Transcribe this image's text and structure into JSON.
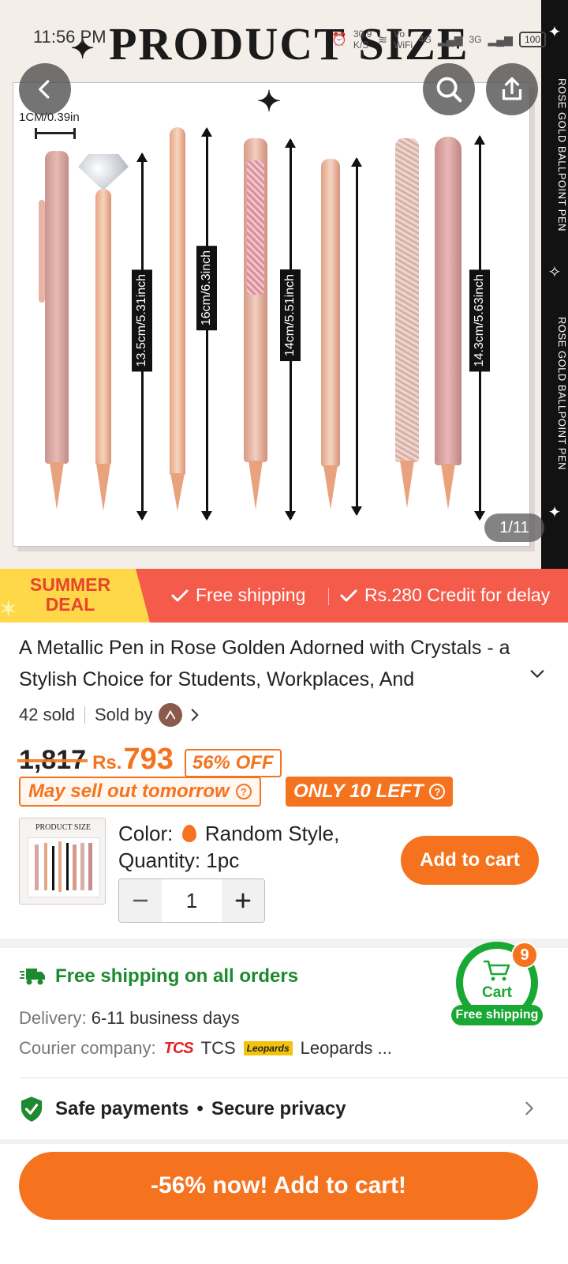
{
  "status_bar": {
    "time": "11:56 PM",
    "net_speed": "30.9 K/S",
    "volte": "Vo WiFi",
    "network_4g": "4G",
    "network_3g": "3G",
    "battery": "100"
  },
  "gallery": {
    "header_text": "PRODUCT SIZE",
    "side_text": "ROSE GOLD BALLPOINT PEN",
    "scale_label": "1CM/0.39in",
    "measurements": [
      "13.5cm/5.31inch",
      "16cm/6.3inch",
      "14cm/5.51inch",
      "14.3cm/5.63inch"
    ],
    "page_indicator": "1/11",
    "back_icon": "chevron-left-icon",
    "search_icon": "search-icon",
    "share_icon": "share-icon"
  },
  "banner": {
    "summer_deal": "SUMMER DEAL",
    "free_shipping": "Free shipping",
    "credit": "Rs.280 Credit for delay"
  },
  "product": {
    "title": "A Metallic Pen in Rose Golden Adorned with Crystals - a Stylish Choice for Students, Workplaces, And",
    "sold": "42 sold",
    "sold_by": "Sold by",
    "original_price": "1,817",
    "currency": "Rs.",
    "price": "793",
    "discount": "56% OFF",
    "sell_out_tag": "May sell out tomorrow",
    "stock_tag": "ONLY 10 LEFT"
  },
  "variant": {
    "thumb_title": "PRODUCT SIZE",
    "color_label": "Color:",
    "color_value": "Random Style,",
    "quantity_line": "Quantity: 1pc",
    "qty_value": "1",
    "add_to_cart": "Add to cart"
  },
  "shipping": {
    "title": "Free shipping on all orders",
    "delivery_label": "Delivery:",
    "delivery_value": "6-11 business days",
    "courier_label": "Courier company:",
    "courier_1_logo": "TCS",
    "courier_1": "TCS",
    "courier_2_logo": "Leopards",
    "courier_2": "Leopards ..."
  },
  "cart_widget": {
    "label": "Cart",
    "badge": "9",
    "free_shipping": "Free shipping"
  },
  "safety": {
    "safe_payments": "Safe payments",
    "bullet": "•",
    "secure_privacy": "Secure privacy"
  },
  "cta": {
    "label": "-56% now! Add to cart!"
  },
  "colors": {
    "accent_orange": "#f5731e",
    "banner_red": "#f45b4b",
    "banner_yellow": "#ffd84a",
    "success_green": "#19a834",
    "rose_gold": "#e8b0a2"
  }
}
